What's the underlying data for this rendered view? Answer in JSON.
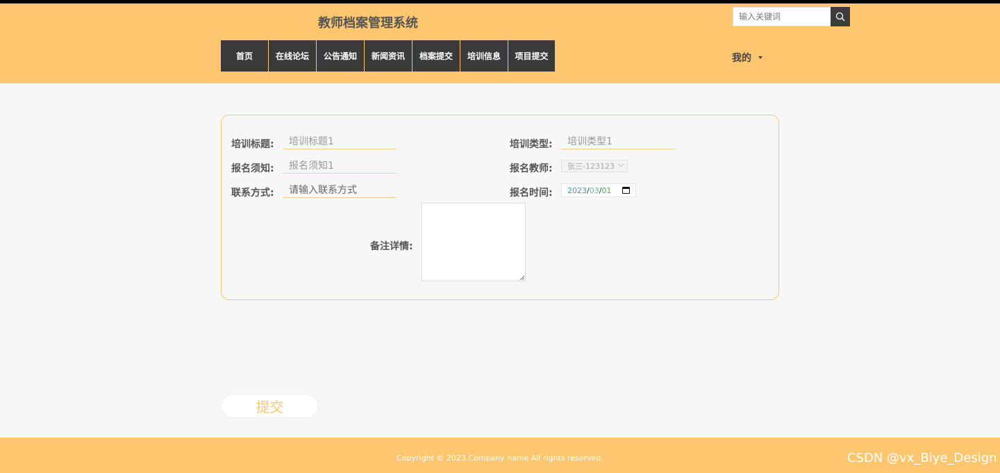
{
  "header": {
    "site_title": "教师档案管理系统",
    "search_placeholder": "输入关键词",
    "search_icon": "search-icon",
    "nav": [
      "首页",
      "在线论坛",
      "公告通知",
      "新闻资讯",
      "档案提交",
      "培训信息",
      "项目提交"
    ],
    "user_menu": "我的"
  },
  "form": {
    "title_label": "培训标题:",
    "title_value": "培训标题1",
    "type_label": "培训类型:",
    "type_value": "培训类型1",
    "notice_label": "报名须知:",
    "notice_value": "报名须知1",
    "teacher_label": "报名教师:",
    "teacher_value": "张三-123123",
    "contact_label": "联系方式:",
    "contact_placeholder": "请输入联系方式",
    "time_label": "报名时间:",
    "date": {
      "year": "2023",
      "month": "03",
      "day": "01",
      "sep": "/"
    },
    "remark_label": "备注详情:"
  },
  "submit_label": "提交",
  "footer": {
    "copyright": "Copyright © 2023.Company name All rights reserved.",
    "watermark": "CSDN @vx_Biye_Design"
  },
  "colors": {
    "accent": "#fec76f",
    "nav_bg": "#3a3a3a"
  }
}
